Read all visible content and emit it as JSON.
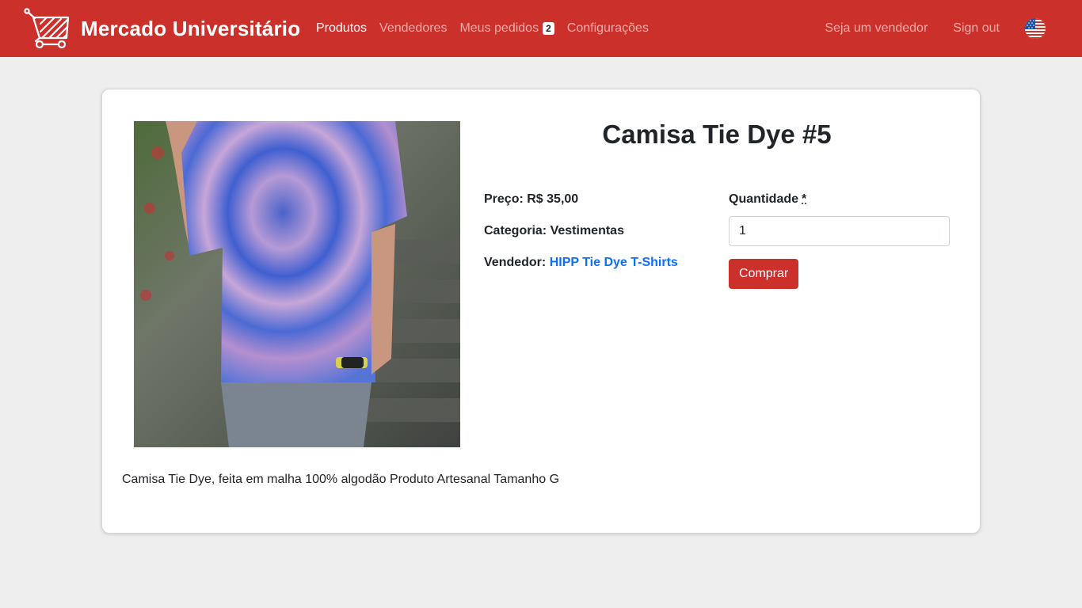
{
  "header": {
    "brand_name": "Mercado Universitário",
    "logo_icon": "shopping-cart-icon",
    "nav": [
      {
        "label": "Produtos",
        "active": true
      },
      {
        "label": "Vendedores",
        "active": false
      },
      {
        "label": "Meus pedidos",
        "badge": "2",
        "active": false
      },
      {
        "label": "Configurações",
        "active": false
      }
    ],
    "become_seller_label": "Seja um vendedor",
    "sign_out_label": "Sign out",
    "language_icon": "us-flag-icon"
  },
  "colors": {
    "primary": "#cc302b",
    "background": "#eeeeee",
    "link": "#0d6efd"
  },
  "product": {
    "title": "Camisa Tie Dye #5",
    "price_label": "Preço:",
    "price": "R$ 35,00",
    "category_label": "Categoria:",
    "category": "Vestimentas",
    "seller_label": "Vendedor:",
    "seller": "HIPP Tie Dye T-Shirts",
    "description": "Camisa Tie Dye, feita em malha 100% algodão Produto Artesanal Tamanho G"
  },
  "purchase": {
    "quantity_label": "Quantidade",
    "required_mark": "*",
    "quantity_value": "1",
    "buy_label": "Comprar"
  }
}
